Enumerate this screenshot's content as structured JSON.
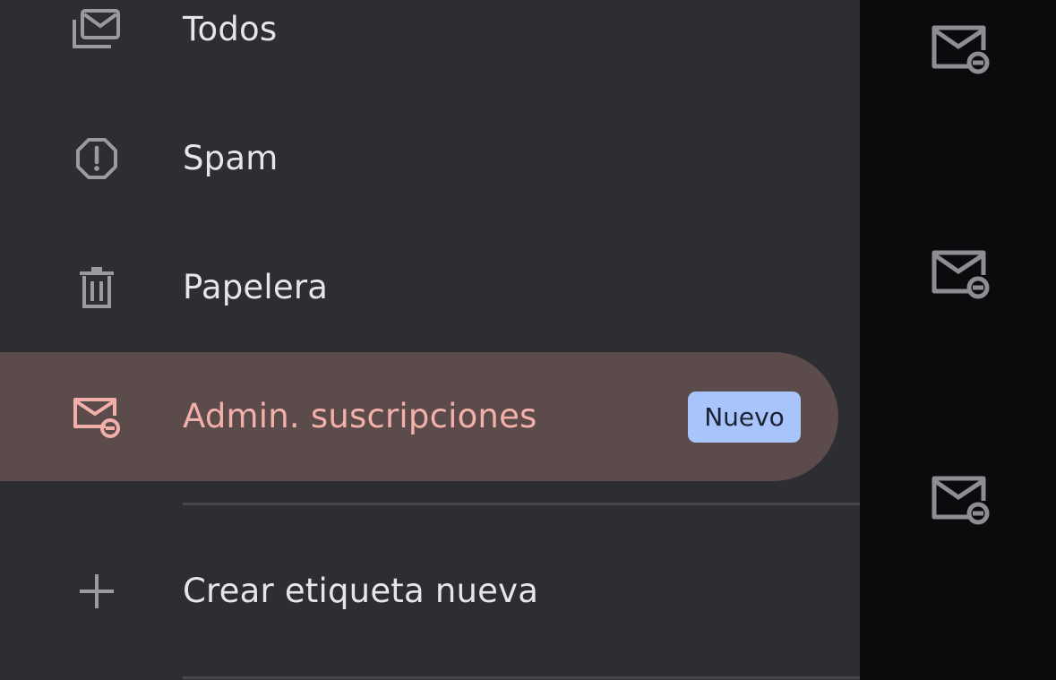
{
  "nav": {
    "items": [
      {
        "label": "Todos",
        "icon": "all-mail-icon"
      },
      {
        "label": "Spam",
        "icon": "spam-icon"
      },
      {
        "label": "Papelera",
        "icon": "trash-icon"
      },
      {
        "label": "Admin. suscripciones",
        "icon": "unsubscribe-mail-icon",
        "badge": "Nuevo",
        "active": true
      },
      {
        "label": "Crear etiqueta nueva",
        "icon": "plus-icon"
      }
    ]
  },
  "right_pane": {
    "icons": [
      "unsubscribe-mail-icon",
      "unsubscribe-mail-icon",
      "unsubscribe-mail-icon"
    ]
  },
  "colors": {
    "drawer_bg": "#2d2e32",
    "active_bg": "#5c4b4b",
    "active_text": "#f3b0aa",
    "badge_bg": "#a8c4fb",
    "icon_gray": "#9a9ba0",
    "pane_bg": "#0b0b0d"
  }
}
